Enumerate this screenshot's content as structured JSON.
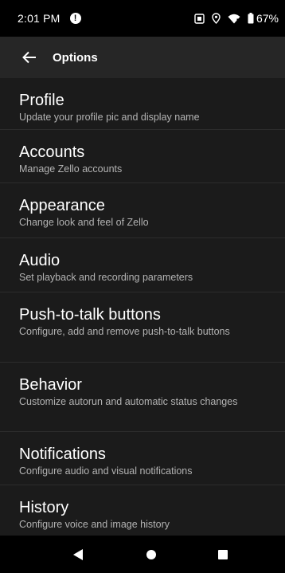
{
  "status_bar": {
    "time": "2:01 PM",
    "alert_glyph": "!",
    "icons": [
      "alert-icon",
      "screenshot-icon",
      "location-icon",
      "wifi-icon",
      "battery-icon"
    ],
    "battery": "67%"
  },
  "app_bar": {
    "back_icon": "arrow-left-icon",
    "title": "Options"
  },
  "items": [
    {
      "title": "Profile",
      "subtitle": "Update your profile pic and display name"
    },
    {
      "title": "Accounts",
      "subtitle": "Manage Zello accounts"
    },
    {
      "title": "Appearance",
      "subtitle": "Change look and feel of Zello"
    },
    {
      "title": "Audio",
      "subtitle": "Set playback and recording parameters"
    },
    {
      "title": "Push-to-talk buttons",
      "subtitle": "Configure, add and remove push-to-talk buttons"
    },
    {
      "title": "Behavior",
      "subtitle": "Customize autorun and automatic status changes"
    },
    {
      "title": "Notifications",
      "subtitle": "Configure audio and visual notifications"
    },
    {
      "title": "History",
      "subtitle": "Configure voice and image history"
    }
  ],
  "nav_bar": {
    "icons": [
      "back-triangle-icon",
      "home-circle-icon",
      "recents-square-icon"
    ]
  },
  "colors": {
    "background": "#1b1b1b",
    "app_bar": "#262626",
    "system_bars": "#000000",
    "subtitle_text": "#b3b3b3",
    "divider": "#2c2c2c"
  }
}
